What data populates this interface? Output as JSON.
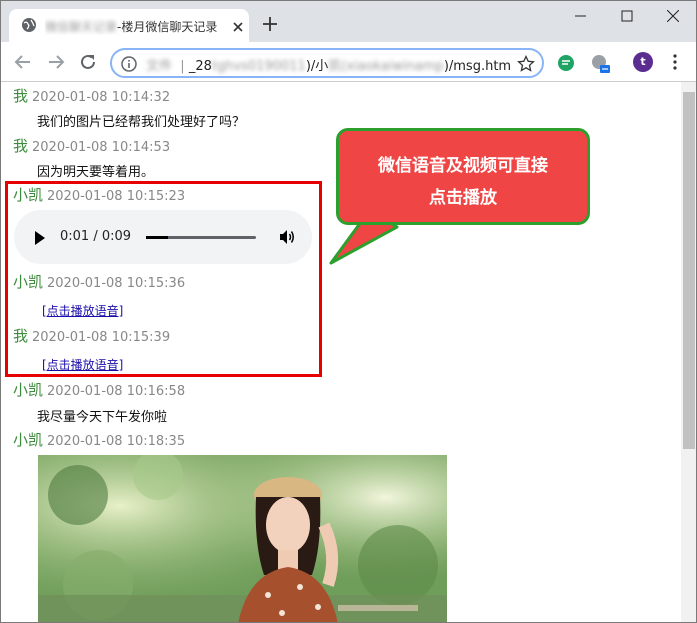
{
  "tab": {
    "title_blurred": "微信聊天记录",
    "title_suffix": "-楼月微信聊天记录"
  },
  "address": {
    "prefix_blurred": "文件",
    "sep": "|",
    "mid_visible": "_28",
    "mid_blurred": "tghvs0190011",
    "mid2": ")/小",
    "mid2_blurred": "凯(xiaokaiwinamp",
    "suffix": ")/msg.htm"
  },
  "profile": {
    "initial": "t"
  },
  "messages": [
    {
      "sender": "我",
      "time": "2020-01-08 10:14:32",
      "text": "我们的图片已经帮我们处理好了吗？"
    },
    {
      "sender": "我",
      "time": "2020-01-08 10:14:53",
      "text": "因为明天要等着用。"
    },
    {
      "sender": "小凯",
      "time": "2020-01-08 10:15:23"
    },
    {
      "sender": "小凯",
      "time": "2020-01-08 10:15:36",
      "link": "[点击播放语音]"
    },
    {
      "sender": "我",
      "time": "2020-01-08 10:15:39",
      "link": "[点击播放语音]"
    },
    {
      "sender": "小凯",
      "time": "2020-01-08 10:16:58",
      "text": "我尽量今天下午发你啦"
    },
    {
      "sender": "小凯",
      "time": "2020-01-08 10:18:35"
    }
  ],
  "audio": {
    "current": "0:01",
    "sep": " / ",
    "duration": "0:09",
    "progress_fraction": 0.2
  },
  "callout": {
    "line1": "微信语音及视频可直接",
    "line2": "点击播放"
  },
  "colors": {
    "sender": "#3c8a3c",
    "highlight_border": "#e60000",
    "callout_fill": "#f04545",
    "callout_border": "#2ca02c"
  }
}
